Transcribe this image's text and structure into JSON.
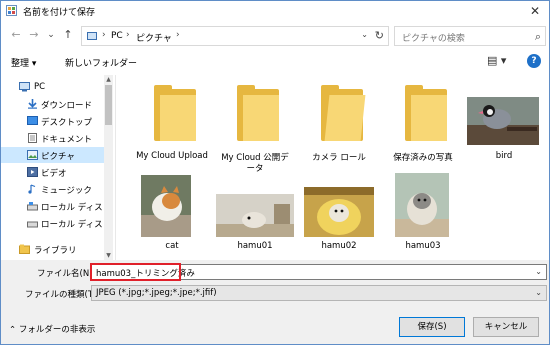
{
  "window": {
    "title": "名前を付けて保存",
    "close_glyph": "✕"
  },
  "navigation": {
    "back_glyph": "←",
    "forward_glyph": "→",
    "recent_glyph": "⌄",
    "up_glyph": "↑",
    "breadcrumb": [
      "PC",
      "ピクチャ"
    ],
    "breadcrumb_sep": "›",
    "refresh_glyph": "↻",
    "search_placeholder": "ピクチャの検索",
    "search_glyph": "⌕"
  },
  "toolbar": {
    "organize_label": "整理 ▾",
    "new_folder_label": "新しいフォルダー",
    "view_glyph": "▤ ▾",
    "help_glyph": "?"
  },
  "nav_pane": {
    "items": [
      {
        "label": "PC",
        "icon": "pc-icon",
        "selected": false
      },
      {
        "label": "ダウンロード",
        "icon": "download-icon",
        "selected": false
      },
      {
        "label": "デスクトップ",
        "icon": "desktop-icon",
        "selected": false
      },
      {
        "label": "ドキュメント",
        "icon": "documents-icon",
        "selected": false
      },
      {
        "label": "ピクチャ",
        "icon": "pictures-icon",
        "selected": true
      },
      {
        "label": "ビデオ",
        "icon": "video-icon",
        "selected": false
      },
      {
        "label": "ミュージック",
        "icon": "music-icon",
        "selected": false
      },
      {
        "label": "ローカル ディスク (C",
        "icon": "drive-icon",
        "selected": false
      },
      {
        "label": "ローカル ディスク (D",
        "icon": "drive-icon",
        "selected": false
      },
      {
        "label": "ライブラリ",
        "icon": "library-icon",
        "selected": false
      }
    ],
    "scroll_up": "▲",
    "scroll_down": "▼"
  },
  "items": [
    {
      "label": "My Cloud Upload",
      "kind": "folder"
    },
    {
      "label": "My Cloud 公開デ",
      "label2": "ータ",
      "kind": "folder"
    },
    {
      "label": "カメラ ロール",
      "kind": "folder"
    },
    {
      "label": "保存済みの写真",
      "kind": "folder"
    },
    {
      "label": "bird",
      "kind": "image"
    },
    {
      "label": "cat",
      "kind": "image"
    },
    {
      "label": "hamu01",
      "kind": "image"
    },
    {
      "label": "hamu02",
      "kind": "image"
    },
    {
      "label": "hamu03",
      "kind": "image"
    }
  ],
  "form": {
    "filename_label": "ファイル名(N):",
    "filename_value": "hamu03_トリミング済み",
    "filetype_label": "ファイルの種類(T):",
    "filetype_value": "JPEG (*.jpg;*.jpeg;*.jpe;*.jfif)",
    "dropdown_glyph": "⌄",
    "hide_folders_label": "⌃  フォルダーの非表示",
    "save_label": "保存(S)",
    "cancel_label": "キャンセル"
  },
  "colors": {
    "selection": "#cce8ff",
    "highlight_border": "#e0202a",
    "folder": "#f8d775",
    "accent": "#0078d7"
  }
}
